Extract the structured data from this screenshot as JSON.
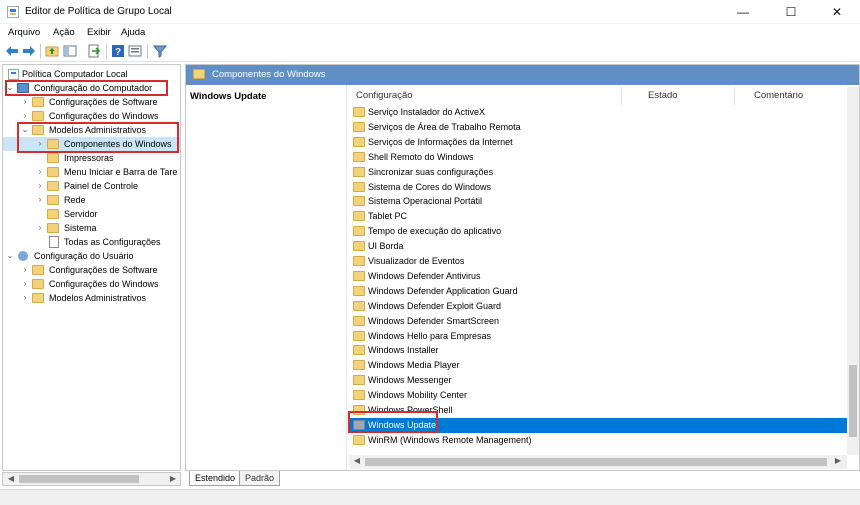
{
  "window": {
    "title": "Editor de Política de Grupo Local",
    "minimize_glyph": "—",
    "maximize_glyph": "☐",
    "close_glyph": "✕"
  },
  "menu": [
    "Arquivo",
    "Ação",
    "Exibir",
    "Ajuda"
  ],
  "toolbar": {
    "icons": [
      "back-arrow-icon",
      "forward-arrow-icon",
      "up-folder-icon",
      "show-hide-tree-icon",
      "export-list-icon",
      "help-icon",
      "properties-icon",
      "filter-icon"
    ]
  },
  "tree": {
    "root": "Política Computador Local",
    "computer": "Configuração do Computador",
    "comp_software": "Configurações de Software",
    "comp_windows": "Configurações do Windows",
    "comp_admin": "Modelos Administrativos",
    "components": "Componentes do Windows",
    "printers": "Impressoras",
    "start_menu": "Menu Iniciar e Barra de Tare",
    "control_panel": "Painel de Controle",
    "network": "Rede",
    "server": "Servidor",
    "system": "Sistema",
    "all_settings": "Todas as Configurações",
    "user": "Configuração do Usuário",
    "user_software": "Configurações de Software",
    "user_windows": "Configurações do Windows",
    "user_admin": "Modelos Administrativos"
  },
  "details": {
    "header": "Componentes do Windows",
    "selected_title": "Windows Update",
    "columns": [
      "Configuração",
      "Estado",
      "Comentário"
    ],
    "items": [
      "Serviço Instalador do ActiveX",
      "Serviços de Área de Trabalho Remota",
      "Serviços de Informações da Internet",
      "Shell Remoto do Windows",
      "Sincronizar suas configurações",
      "Sistema de Cores do Windows",
      "Sistema Operacional Portátil",
      "Tablet PC",
      "Tempo de execução do aplicativo",
      "UI Borda",
      "Visualizador de Eventos",
      "Windows Defender Antivirus",
      "Windows Defender Application Guard",
      "Windows Defender Exploit Guard",
      "Windows Defender SmartScreen",
      "Windows Hello para Empresas",
      "Windows Installer",
      "Windows Media Player",
      "Windows Messenger",
      "Windows Mobility Center",
      "Windows PowerShell",
      "Windows Update",
      "WinRM (Windows Remote Management)"
    ],
    "selected_item": "Windows Update"
  },
  "tabs": [
    "Estendido",
    "Padrão"
  ],
  "colors": {
    "selection": "#0078d7",
    "header_band": "#5f8fc5",
    "highlight_box": "#d52b2b"
  }
}
